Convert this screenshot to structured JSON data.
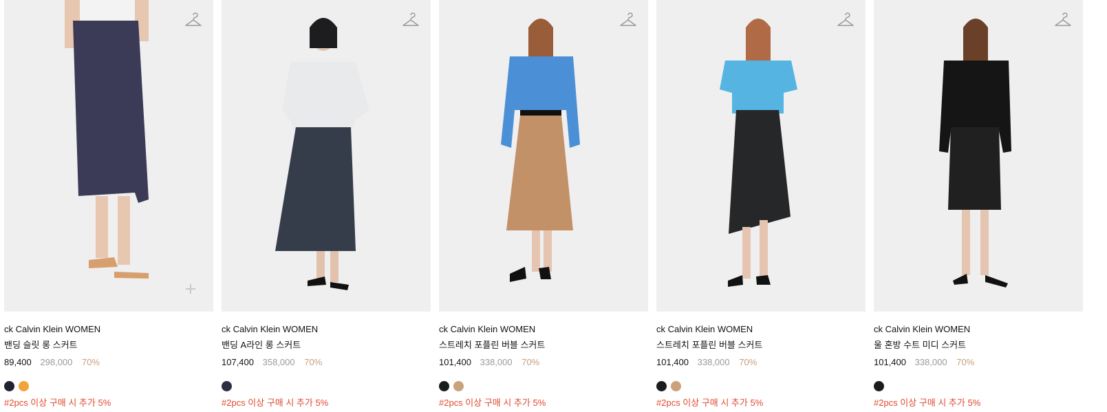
{
  "products": [
    {
      "brand": "ck Calvin Klein WOMEN",
      "name": "밴딩 슬릿 롱 스커트",
      "price": "89,400",
      "original_price": "298,000",
      "discount": "70%",
      "swatches": [
        "#1f2230",
        "#f2a33a"
      ],
      "promo": "#2pcs 이상 구매 시 추가 5%",
      "colors": {
        "top": "#f3f3f3",
        "skirt": "#3b3a57"
      },
      "icon": "hanger-icon"
    },
    {
      "brand": "ck Calvin Klein WOMEN",
      "name": "밴딩 A라인 롱 스커트",
      "price": "107,400",
      "original_price": "358,000",
      "discount": "70%",
      "swatches": [
        "#2b2f3f"
      ],
      "promo": "#2pcs 이상 구매 시 추가 5%",
      "colors": {
        "top": "#e9eaeb",
        "skirt": "#363d4a"
      },
      "icon": "hanger-icon"
    },
    {
      "brand": "ck Calvin Klein WOMEN",
      "name": "스트레치 포플린 버블 스커트",
      "price": "101,400",
      "original_price": "338,000",
      "discount": "70%",
      "swatches": [
        "#1c1c1c",
        "#c9a17c"
      ],
      "promo": "#2pcs 이상 구매 시 추가 5%",
      "colors": {
        "top": "#4b90d6",
        "skirt": "#c39168"
      },
      "icon": "hanger-icon"
    },
    {
      "brand": "ck Calvin Klein WOMEN",
      "name": "스트레치 포플린 버블 스커트",
      "price": "101,400",
      "original_price": "338,000",
      "discount": "70%",
      "swatches": [
        "#1c1c1c",
        "#c9a17c"
      ],
      "promo": "#2pcs 이상 구매 시 추가 5%",
      "colors": {
        "top": "#56b4e2",
        "skirt": "#262729"
      },
      "icon": "hanger-icon"
    },
    {
      "brand": "ck Calvin Klein WOMEN",
      "name": "울 혼방 수트 미디 스커트",
      "price": "101,400",
      "original_price": "338,000",
      "discount": "70%",
      "swatches": [
        "#1c1c1c"
      ],
      "promo": "#2pcs 이상 구매 시 추가 5%",
      "colors": {
        "top": "#151515",
        "skirt": "#202020"
      },
      "icon": "hanger-icon"
    }
  ]
}
